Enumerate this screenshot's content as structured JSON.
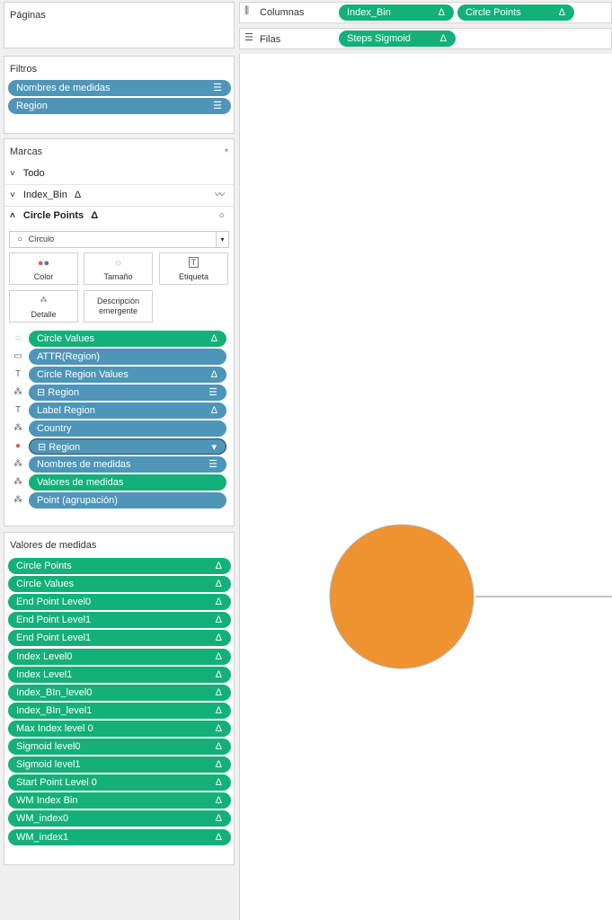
{
  "pages": {
    "title": "Páginas"
  },
  "filters": {
    "title": "Filtros",
    "items": [
      {
        "label": "Nombres de medidas",
        "icon": "sort-icon"
      },
      {
        "label": "Region",
        "icon": "sort-icon"
      }
    ]
  },
  "marks": {
    "title": "Marcas",
    "rows": [
      {
        "label": "Todo"
      },
      {
        "label": "Index_Bin",
        "delta": "Δ"
      },
      {
        "label": "Circle Points",
        "delta": "Δ"
      }
    ],
    "mark_type": "Círculo",
    "buttons": {
      "color": "Color",
      "size": "Tamaño",
      "label": "Etiqueta",
      "detail": "Detalle",
      "tooltip": "Descripción emergente"
    },
    "cards": [
      {
        "label": "Circle Values",
        "trail": "Δ",
        "color": "#14b07a"
      },
      {
        "label": "ATTR(Region)",
        "trail": "",
        "color": "#4e95b8"
      },
      {
        "label": "Circle Region Values",
        "trail": "Δ",
        "color": "#4e95b8"
      },
      {
        "label": "Region",
        "trail": "☰",
        "color": "#4e95b8"
      },
      {
        "label": "Label Region",
        "trail": "Δ",
        "color": "#4e95b8"
      },
      {
        "label": "Country",
        "trail": "",
        "color": "#4e95b8"
      },
      {
        "label": "Region",
        "trail": "▾",
        "color": "#4e95b8"
      },
      {
        "label": "Nombres de medidas",
        "trail": "☰",
        "color": "#4e95b8"
      },
      {
        "label": "Valores de medidas",
        "trail": "",
        "color": "#14b07a"
      },
      {
        "label": "Point (agrupación)",
        "trail": "",
        "color": "#4e95b8"
      }
    ]
  },
  "measure_values": {
    "title": "Valores de medidas",
    "items": [
      "Circle Points",
      "Circle Values",
      "End Point Level0",
      "End Point Level1",
      "End Point Level1",
      "Index Level0",
      "Index Level1",
      "Index_BIn_level0",
      "Index_BIn_level1",
      "Max Index level 0",
      "Sigmoid level0",
      "Sigmoid level1",
      "Start Point Level 0",
      "WM Index Bin",
      "WM_index0",
      "WM_index1"
    ],
    "delta": "Δ"
  },
  "shelves": {
    "columns_label": "Columnas",
    "rows_label": "Filas",
    "columns": [
      {
        "label": "Index_Bin",
        "delta": "Δ"
      },
      {
        "label": "Circle Points",
        "delta": "Δ"
      }
    ],
    "rows": [
      {
        "label": "Steps Sigmoid",
        "delta": "Δ"
      }
    ]
  },
  "canvas": {
    "circle_color": "#ef9330",
    "line_color": "#8a8a8a"
  },
  "colors": {
    "dimension_pill": "#4e95b8",
    "measure_pill": "#14b07a"
  }
}
